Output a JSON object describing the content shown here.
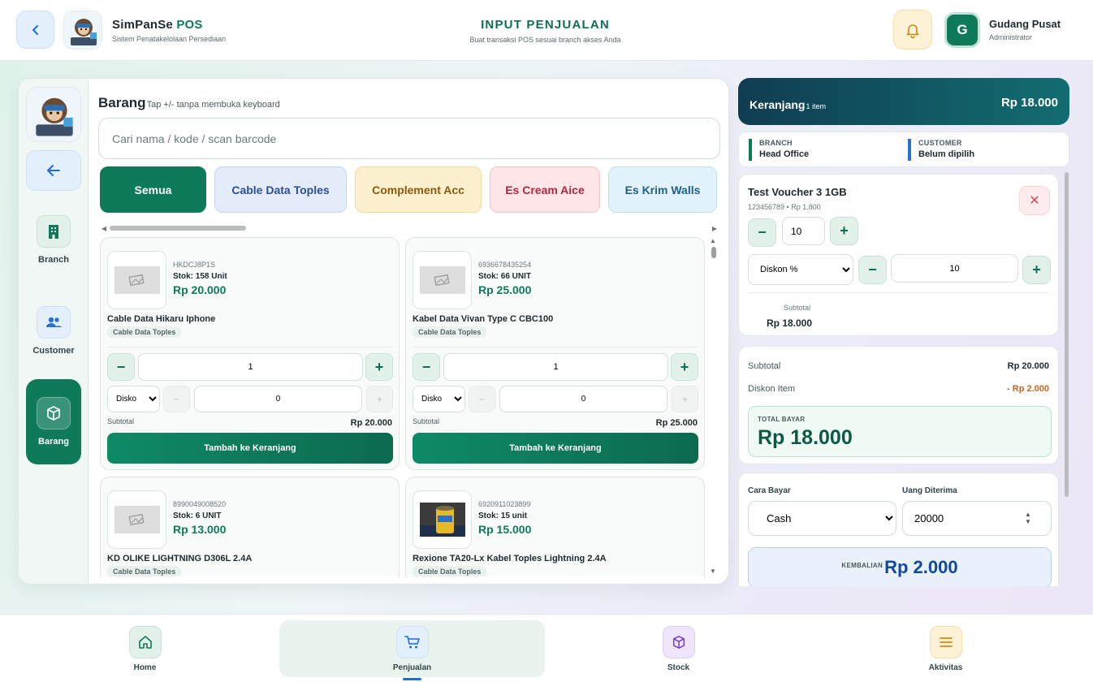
{
  "header": {
    "brand_name": "SimPanSe",
    "brand_suffix": "POS",
    "brand_subtitle": "Sistem Penatakelolaan Persediaan",
    "page_title": "INPUT PENJUALAN",
    "page_subtitle": "Buat transaksi POS sesuai branch akses Anda",
    "user_initial": "G",
    "user_name": "Gudang Pusat",
    "user_role": "Administrator"
  },
  "sidebar": {
    "items": [
      {
        "label": "Branch",
        "icon": "building-icon"
      },
      {
        "label": "Customer",
        "icon": "users-icon"
      },
      {
        "label": "Barang",
        "icon": "box-icon",
        "active": true
      }
    ]
  },
  "products_section": {
    "title": "Barang",
    "hint": "Tap +/- tanpa membuka keyboard",
    "search_placeholder": "Cari nama / kode / scan barcode",
    "categories": [
      {
        "label": "Semua",
        "active": true
      },
      {
        "label": "Cable Data Toples"
      },
      {
        "label": "Complement Acc"
      },
      {
        "label": "Es Cream Aice"
      },
      {
        "label": "Es Krim Walls"
      }
    ],
    "products": [
      {
        "code": "HKDCJ8P1S",
        "stock": "Stok: 158 Unit",
        "price": "Rp 20.000",
        "name": "Cable Data Hikaru Iphone",
        "category": "Cable Data Toples",
        "qty": "1",
        "discount_type": "Disko",
        "discount": "0",
        "subtotal_label": "Subtotal",
        "subtotal": "Rp 20.000",
        "add_label": "Tambah ke Keranjang",
        "image": "no-image"
      },
      {
        "code": "6936678435254",
        "stock": "Stok: 66 UNIT",
        "price": "Rp 25.000",
        "name": "Kabel Data Vivan Type C CBC100",
        "category": "Cable Data Toples",
        "qty": "1",
        "discount_type": "Disko",
        "discount": "0",
        "subtotal_label": "Subtotal",
        "subtotal": "Rp 25.000",
        "add_label": "Tambah ke Keranjang",
        "image": "no-image"
      },
      {
        "code": "8990049008520",
        "stock": "Stok: 6 UNIT",
        "price": "Rp 13.000",
        "name": "KD OLIKE LIGHTNING D306L 2.4A",
        "category": "Cable Data Toples",
        "image": "no-image"
      },
      {
        "code": "6920911023899",
        "stock": "Stok: 15 unit",
        "price": "Rp 15.000",
        "name": "Rexione TA20-Lx Kabel Toples Lightning 2.4A",
        "category": "Cable Data Toples",
        "image": "product-photo"
      }
    ]
  },
  "cart": {
    "title": "Keranjang",
    "count": "1 item",
    "total": "Rp 18.000",
    "branch_label": "BRANCH",
    "branch_value": "Head Office",
    "customer_label": "CUSTOMER",
    "customer_value": "Belum dipilih",
    "item": {
      "name": "Test Voucher 3 1GB",
      "meta": "123456789 • Rp 1.800",
      "qty": "10",
      "discount_type": "Diskon %",
      "discount": "10",
      "subtotal_label": "Subtotal",
      "subtotal": "Rp 18.000"
    },
    "summary": {
      "subtotal_label": "Subtotal",
      "subtotal": "Rp 20.000",
      "discount_label": "Diskon Item",
      "discount": "- Rp 2.000",
      "total_label": "TOTAL BAYAR",
      "total": "Rp 18.000"
    },
    "payment": {
      "method_label": "Cara Bayar",
      "method": "Cash",
      "received_label": "Uang Diterima",
      "received": "20000",
      "change_label": "KEMBALIAN",
      "change": "Rp 2.000"
    }
  },
  "bottom_nav": [
    {
      "label": "Home",
      "icon": "home-icon"
    },
    {
      "label": "Penjualan",
      "icon": "cart-icon",
      "active": true
    },
    {
      "label": "Stock",
      "icon": "cube-icon"
    },
    {
      "label": "Aktivitas",
      "icon": "menu-icon"
    }
  ],
  "colors": {
    "primary": "#0f7a5a",
    "cart_header": "#0f3d52",
    "discount": "#c0672a",
    "change": "#114a9a"
  }
}
